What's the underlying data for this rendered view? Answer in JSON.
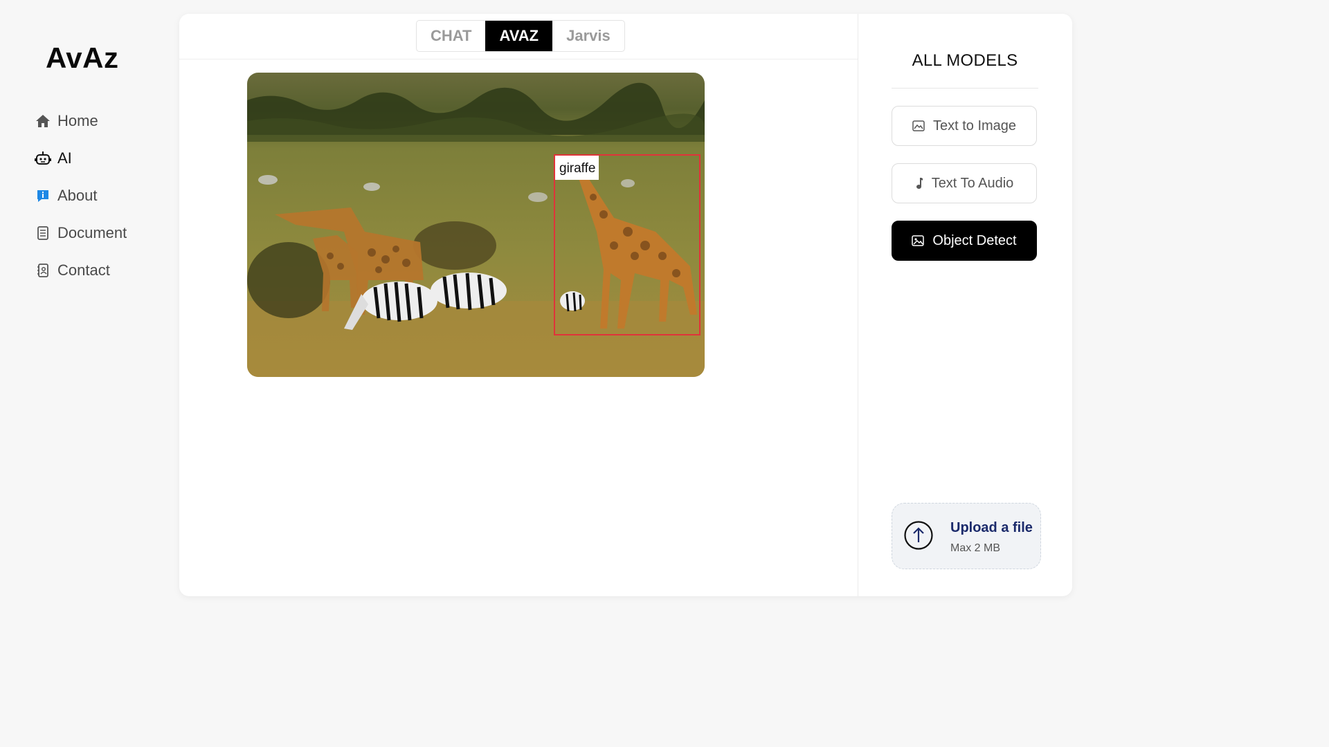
{
  "app": {
    "logo": "AvAz"
  },
  "sidebar": {
    "items": [
      {
        "label": "Home",
        "icon": "home-icon"
      },
      {
        "label": "AI",
        "icon": "robot-icon"
      },
      {
        "label": "About",
        "icon": "info-icon"
      },
      {
        "label": "Document",
        "icon": "document-icon"
      },
      {
        "label": "Contact",
        "icon": "contact-book-icon"
      }
    ],
    "active_item": "AI"
  },
  "tabs": {
    "items": [
      "CHAT",
      "AVAZ",
      "Jarvis"
    ],
    "active": "AVAZ"
  },
  "detection": {
    "label": "giraffe",
    "box_color": "#e0333a"
  },
  "models": {
    "title": "ALL MODELS",
    "buttons": [
      {
        "label": "Text to Image",
        "icon": "image-edit-icon"
      },
      {
        "label": "Text To Audio",
        "icon": "music-note-icon"
      },
      {
        "label": "Object Detect",
        "icon": "image-icon"
      }
    ],
    "active": "Object Detect"
  },
  "upload": {
    "title": "Upload a file",
    "subtitle": "Max 2 MB",
    "icon": "upload-arrow-icon"
  },
  "colors": {
    "accent": "#000000",
    "upload_text": "#1b2a6b",
    "info_icon": "#1e88e5"
  }
}
